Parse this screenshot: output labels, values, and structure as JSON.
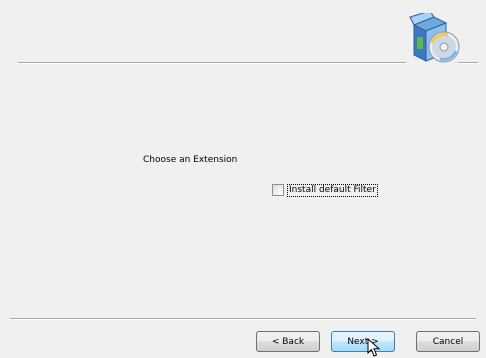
{
  "main": {
    "choose_label": "Choose an Extension",
    "checkbox_label": "Install default Filter",
    "checkbox_checked": false
  },
  "footer": {
    "back_label": "< Back",
    "next_label": "Next >",
    "cancel_label": "Cancel"
  },
  "icons": {
    "header_icon": "setup-cd-icon",
    "cursor": "mouse-pointer-icon"
  }
}
